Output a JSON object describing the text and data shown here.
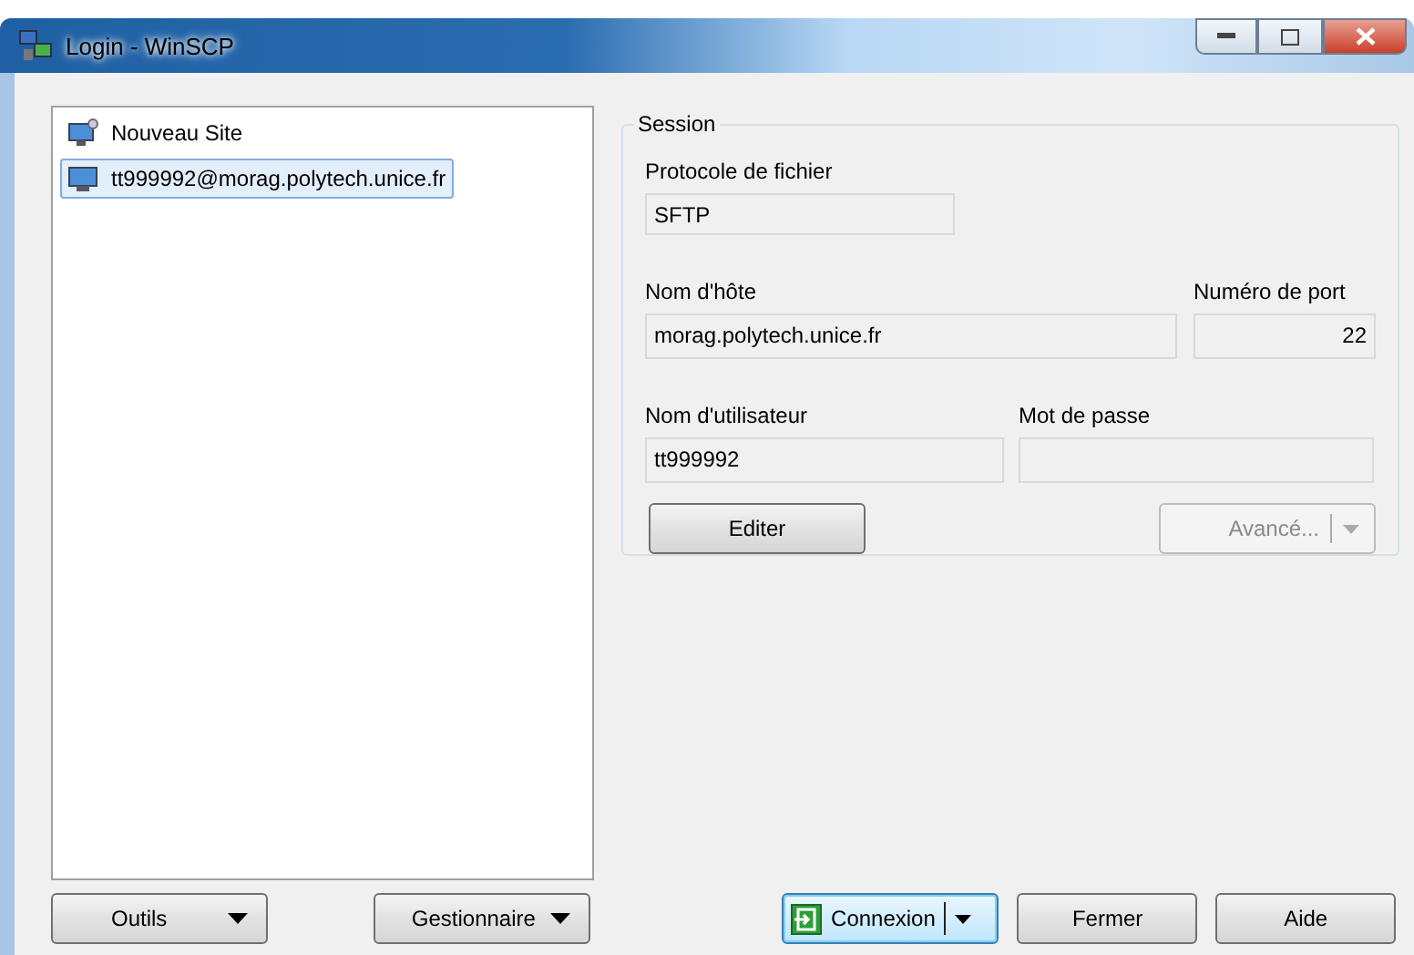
{
  "window": {
    "title": "Login - WinSCP"
  },
  "sites": [
    {
      "label": "Nouveau Site",
      "kind": "new",
      "selected": false
    },
    {
      "label": "tt999992@morag.polytech.unice.fr",
      "kind": "session",
      "selected": true
    }
  ],
  "session": {
    "title": "Session",
    "protocol": {
      "label": "Protocole de fichier",
      "value": "SFTP"
    },
    "host": {
      "label": "Nom d'hôte",
      "value": "morag.polytech.unice.fr"
    },
    "port": {
      "label": "Numéro de port",
      "value": "22"
    },
    "user": {
      "label": "Nom d'utilisateur",
      "value": "tt999992"
    },
    "password": {
      "label": "Mot de passe"
    },
    "edit_button": {
      "label": "Editer",
      "disabled": false
    },
    "advanced_button": {
      "label": "Avancé...",
      "disabled": true
    }
  },
  "left_buttons": [
    {
      "label": "Outils"
    },
    {
      "label": "Gestionnaire"
    }
  ],
  "right_buttons": [
    {
      "label": "Connexion",
      "kind": "split-default"
    },
    {
      "label": "Fermer",
      "kind": "plain"
    },
    {
      "label": "Aide",
      "kind": "plain"
    }
  ]
}
